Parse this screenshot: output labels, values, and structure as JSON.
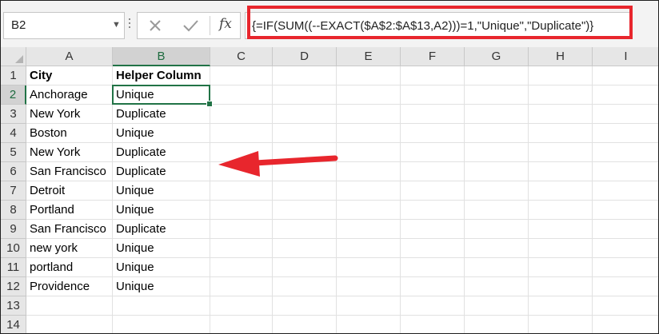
{
  "name_box": {
    "value": "B2"
  },
  "formula_bar": {
    "formula": "{=IF(SUM((--EXACT($A$2:$A$13,A2)))=1,\"Unique\",\"Duplicate\")}",
    "fx_label": "fx",
    "highlight_color": "#e8262d"
  },
  "columns": [
    "A",
    "B",
    "C",
    "D",
    "E",
    "F",
    "G",
    "H",
    "I"
  ],
  "rows": [
    "1",
    "2",
    "3",
    "4",
    "5",
    "6",
    "7",
    "8",
    "9",
    "10",
    "11",
    "12",
    "13",
    "14"
  ],
  "selected": {
    "column": "B",
    "row": "2"
  },
  "cells": [
    [
      "City",
      "Helper Column"
    ],
    [
      "Anchorage",
      "Unique"
    ],
    [
      "New York",
      "Duplicate"
    ],
    [
      "Boston",
      "Unique"
    ],
    [
      "New York",
      "Duplicate"
    ],
    [
      "San Francisco",
      "Duplicate"
    ],
    [
      "Detroit",
      "Unique"
    ],
    [
      "Portland",
      "Unique"
    ],
    [
      "San Francisco",
      "Duplicate"
    ],
    [
      "new york",
      "Unique"
    ],
    [
      "portland",
      "Unique"
    ],
    [
      "Providence",
      "Unique"
    ],
    [
      "",
      ""
    ],
    [
      "",
      ""
    ]
  ],
  "icons": {
    "cancel": "close-icon",
    "enter": "checkmark-icon",
    "insert_function": "fx-icon",
    "annotation": "red-arrow-icon"
  },
  "colors": {
    "accent": "#217346",
    "arrow": "#e8262d"
  }
}
